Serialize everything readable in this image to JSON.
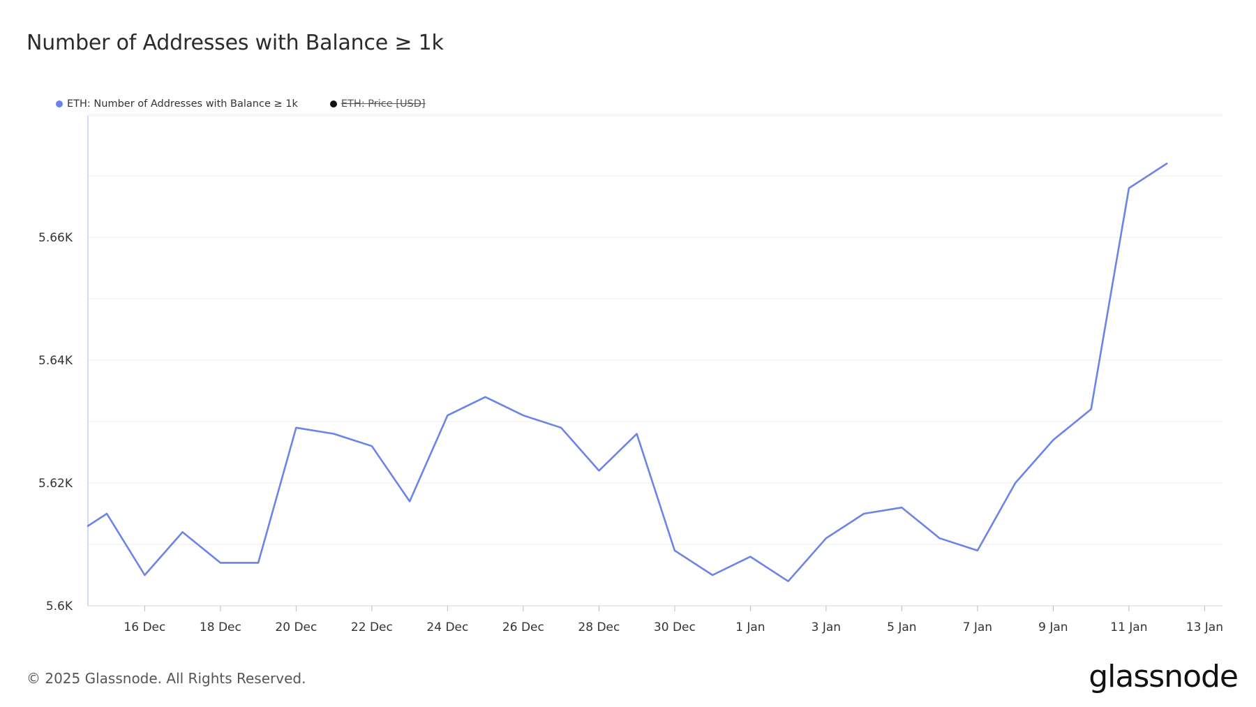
{
  "title": "Number of Addresses with Balance ≥ 1k",
  "legend": [
    {
      "label": "ETH: Number of Addresses with Balance ≥ 1k",
      "color": "#6b84e6",
      "active": true
    },
    {
      "label": "ETH: Price [USD]",
      "color": "#111111",
      "active": false
    }
  ],
  "footer": "© 2025 Glassnode. All Rights Reserved.",
  "brand": "glassnode",
  "chart_data": {
    "type": "line",
    "title": "Number of Addresses with Balance ≥ 1k",
    "x_tick_labels": [
      "16 Dec",
      "18 Dec",
      "20 Dec",
      "22 Dec",
      "24 Dec",
      "26 Dec",
      "28 Dec",
      "30 Dec",
      "1 Jan",
      "3 Jan",
      "5 Jan",
      "7 Jan",
      "9 Jan",
      "11 Jan",
      "13 Jan"
    ],
    "y_tick_labels": [
      "5.6K",
      "5.62K",
      "5.64K",
      "5.66K"
    ],
    "y_ticks": [
      5600,
      5620,
      5640,
      5660
    ],
    "ylim": [
      5600,
      5680
    ],
    "xlim": [
      "2024-12-14T12:00",
      "2025-01-13T12:00"
    ],
    "grid": true,
    "legend_position": "top-left",
    "series": [
      {
        "name": "ETH: Number of Addresses with Balance ≥ 1k",
        "color": "#6b84e6",
        "x": [
          "2024-12-14T12:00",
          "2024-12-15",
          "2024-12-16",
          "2024-12-17",
          "2024-12-18",
          "2024-12-19",
          "2024-12-20",
          "2024-12-21",
          "2024-12-22",
          "2024-12-23",
          "2024-12-24",
          "2024-12-25",
          "2024-12-26",
          "2024-12-27",
          "2024-12-28",
          "2024-12-29",
          "2024-12-30",
          "2024-12-31",
          "2025-01-01",
          "2025-01-02",
          "2025-01-03",
          "2025-01-04",
          "2025-01-05",
          "2025-01-06",
          "2025-01-07",
          "2025-01-08",
          "2025-01-09",
          "2025-01-10",
          "2025-01-11",
          "2025-01-12"
        ],
        "values": [
          5613,
          5615,
          5605,
          5612,
          5607,
          5607,
          5629,
          5628,
          5626,
          5617,
          5631,
          5634,
          5631,
          5629,
          5622,
          5628,
          5609,
          5605,
          5608,
          5604,
          5611,
          5615,
          5616,
          5611,
          5609,
          5620,
          5627,
          5632,
          5668,
          5672
        ]
      }
    ]
  }
}
